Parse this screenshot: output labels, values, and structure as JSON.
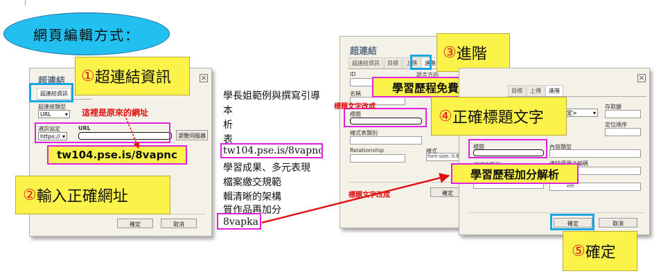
{
  "oval_text": "網頁編輯方式：",
  "dialog_left": {
    "title": "超連結",
    "tabs": [
      "超連結資訊",
      "目標",
      "上傳",
      "進階"
    ],
    "link_type_label": "超連接類型",
    "link_type_value": "URL",
    "protocol_label": "通訊協定",
    "protocol_value": "https://",
    "url_label": "URL",
    "browse_button": "瀏覽伺服器",
    "ok_button": "確定",
    "cancel_button": "取消"
  },
  "dialog_mid": {
    "title": "超連結",
    "tabs": [
      "超連結資訊",
      "目標",
      "上傳",
      "進階"
    ],
    "id_label": "ID",
    "lang_direction_label": "語言方向",
    "name_label": "名稱",
    "title_label": "標題",
    "stylesheet_label": "樣式表類別",
    "relationship_label": "Relationship",
    "style_label": "樣式",
    "style_value": "font-size: 0.62",
    "ok_button": "確定"
  },
  "dialog_right": {
    "tabs": [
      "目標",
      "上傳",
      "進階"
    ],
    "access_key_label": "存取鍵",
    "tab_order_label": "定位順序",
    "content_type_label": "內容類型",
    "title_label": "標題",
    "stylesheet_label": "樣式表類別",
    "charset_label": "連結資源之編碼",
    "select_value": "定>",
    "style_value_partial": "em",
    "ok_button": "確定",
    "cancel_button": "取消"
  },
  "callouts": {
    "c1_num": "①",
    "c1_text": "超連結資訊",
    "c2_num": "②",
    "c2_text": "輸入正確網址",
    "c3_num": "③",
    "c3_text": "進階",
    "c4_num": "④",
    "c4_text": "正確標題文字",
    "c5_num": "⑤",
    "c5_text": "確定"
  },
  "labels": {
    "original_url_note": "這裡是原來的網址",
    "new_url": "tw104.pse.is/8vapnc",
    "title_change_1": "標題文字改成",
    "title_change_2": "標題文字改成",
    "title_text_1": "學習歷程免費服務",
    "title_text_2": "學習歷程加分解析"
  },
  "doc_lines": [
    "學長姐範例與撰寫引導",
    "本",
    "析",
    "表",
    "tw104.pse.is/8vapnc",
    "學習成果、多元表現",
    "檔案繳交規範",
    "輯清晰的架構",
    "質作品再加分",
    "8vapka"
  ],
  "colors": {
    "oval": "#22c0f0",
    "callout_yellow": "#fbf34a",
    "highlight_magenta": "#e020e0",
    "highlight_cyan": "#17a6df",
    "arrow_red": "#e01010"
  }
}
